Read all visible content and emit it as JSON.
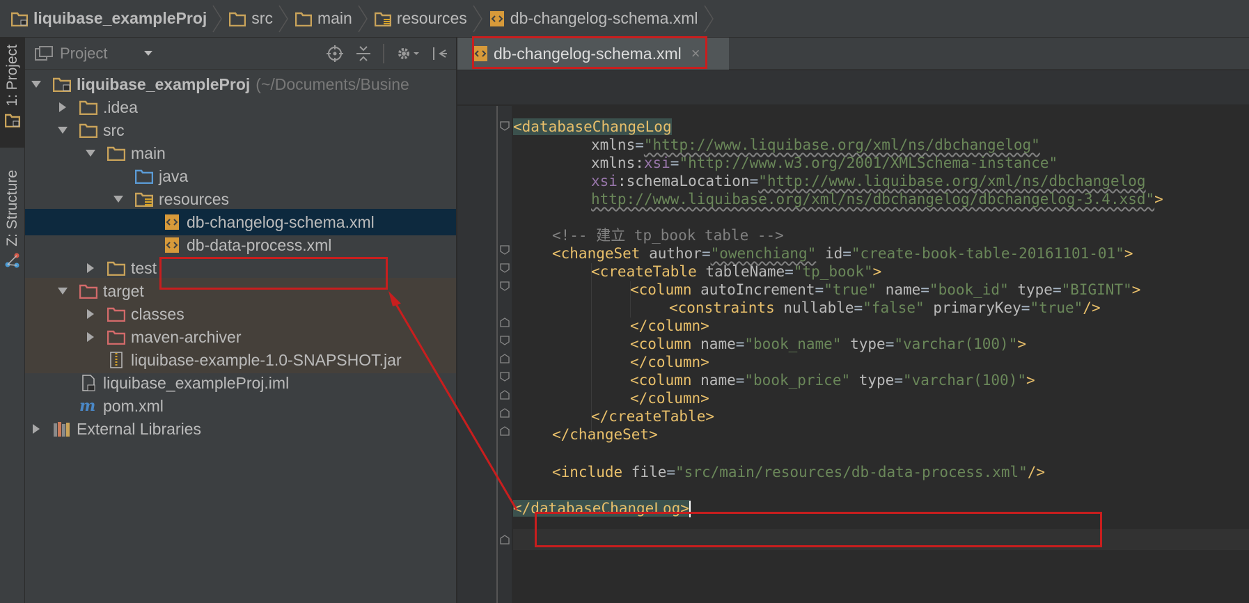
{
  "breadcrumb": [
    {
      "label": "liquibase_exampleProj",
      "icon": "module-folder-icon"
    },
    {
      "label": "src",
      "icon": "folder-icon"
    },
    {
      "label": "main",
      "icon": "folder-icon"
    },
    {
      "label": "resources",
      "icon": "resources-folder-icon"
    },
    {
      "label": "db-changelog-schema.xml",
      "icon": "xml-file-icon"
    }
  ],
  "toolwindows": {
    "project_label": "1: Project",
    "structure_label": "Z: Structure"
  },
  "project_panel": {
    "title": "Project",
    "tree": [
      {
        "name": "liquibase_exampleProj",
        "hint": "(~/Documents/Busine",
        "icon": "module-folder-icon",
        "expanded": true
      },
      {
        "name": ".idea",
        "icon": "folder-icon",
        "expanded": false
      },
      {
        "name": "src",
        "icon": "folder-icon",
        "expanded": true
      },
      {
        "name": "main",
        "icon": "folder-icon",
        "expanded": true
      },
      {
        "name": "java",
        "icon": "source-folder-icon"
      },
      {
        "name": "resources",
        "icon": "resources-folder-icon",
        "expanded": true
      },
      {
        "name": "db-changelog-schema.xml",
        "icon": "xml-file-icon",
        "selected": true
      },
      {
        "name": "db-data-process.xml",
        "icon": "xml-file-icon"
      },
      {
        "name": "test",
        "icon": "folder-icon",
        "expanded": false
      },
      {
        "name": "target",
        "icon": "excluded-folder-icon",
        "expanded": true
      },
      {
        "name": "classes",
        "icon": "excluded-folder-icon",
        "expanded": false
      },
      {
        "name": "maven-archiver",
        "icon": "excluded-folder-icon",
        "expanded": false
      },
      {
        "name": "liquibase-example-1.0-SNAPSHOT.jar",
        "icon": "jar-file-icon"
      },
      {
        "name": "liquibase_exampleProj.iml",
        "icon": "iml-file-icon"
      },
      {
        "name": "pom.xml",
        "icon": "maven-icon"
      },
      {
        "name": "External Libraries",
        "icon": "libraries-icon",
        "expanded": false
      }
    ]
  },
  "editor": {
    "tab_label": "db-changelog-schema.xml",
    "tab_close": "×",
    "code": {
      "l1_tag": "databaseChangeLog",
      "l2_attr": "xmlns",
      "l2_val": "\"http://www.liquibase.org/xml/ns/dbchangelog\"",
      "l3_attr": "xmlns:",
      "l3_ns": "xsi",
      "l3_val": "\"http://www.w3.org/2001/XMLSchema-instance\"",
      "l4_ns": "xsi",
      "l4_attr": ":schemaLocation",
      "l4_val": "\"http://www.liquibase.org/xml/ns/dbchangelog",
      "l5_val": "http://www.liquibase.org/xml/ns/dbchangelog/dbchangelog-3.4.xsd\"",
      "comment": "<!-- 建立 tp_book table -->",
      "changeset_author_val": "\"owenchiang\"",
      "changeset_id_val": "\"create-book-table-20161101-01\"",
      "createtable_name_val": "\"tp_book\"",
      "col1_autoinc_val": "\"true\"",
      "col1_name_val": "\"book_id\"",
      "col1_type_val": "\"BIGINT\"",
      "constraints_nullable_val": "\"false\"",
      "constraints_pk_val": "\"true\"",
      "col2_name_val": "\"book_name\"",
      "col2_type_val": "\"varchar(100)\"",
      "col3_name_val": "\"book_price\"",
      "col3_type_val": "\"varchar(100)\"",
      "include_file_val": "\"src/main/resources/db-data-process.xml\""
    }
  },
  "colors": {
    "annotation_red": "#c81e1e",
    "tag": "#e8bf6a",
    "value": "#6a8759",
    "namespace": "#9876aa"
  }
}
